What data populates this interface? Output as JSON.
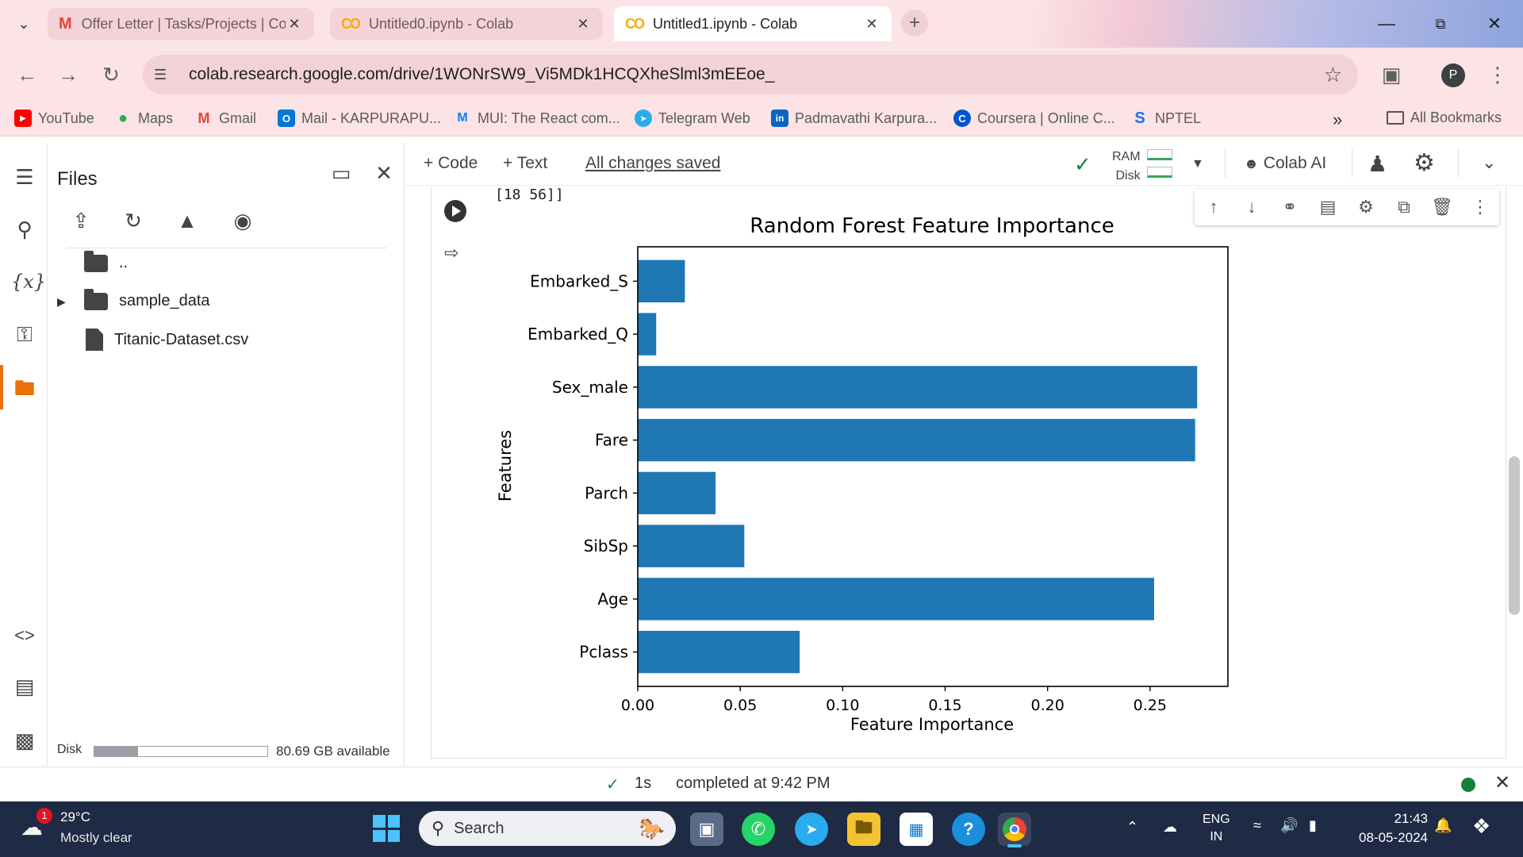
{
  "browser": {
    "tabs": [
      {
        "label": "Offer Letter | Tasks/Projects | Co",
        "icon": "gmail-icon"
      },
      {
        "label": "Untitled0.ipynb - Colab",
        "icon": "colab-icon"
      },
      {
        "label": "Untitled1.ipynb - Colab",
        "icon": "colab-icon"
      }
    ],
    "url": "colab.research.google.com/drive/1WONrSW9_Vi5MDk1HCQXheSlml3mEEoe_",
    "profile_initial": "P",
    "bookmarks": [
      {
        "label": "YouTube",
        "color": "#ff0000"
      },
      {
        "label": "Maps",
        "color": "#34a853"
      },
      {
        "label": "Gmail",
        "color": "#ea4335"
      },
      {
        "label": "Mail - KARPURAPU...",
        "color": "#0078d4"
      },
      {
        "label": "MUI: The React com...",
        "color": "#007fff"
      },
      {
        "label": "Telegram Web",
        "color": "#2aabee"
      },
      {
        "label": "Padmavathi Karpura...",
        "color": "#0a66c2"
      },
      {
        "label": "Coursera | Online C...",
        "color": "#0056d2"
      },
      {
        "label": "NPTEL",
        "color": "#1a73e8"
      }
    ],
    "all_bookmarks": "All Bookmarks"
  },
  "files": {
    "title": "Files",
    "parent": "..",
    "items": [
      {
        "name": "sample_data",
        "type": "folder"
      },
      {
        "name": "Titanic-Dataset.csv",
        "type": "file"
      }
    ],
    "disk_label": "Disk",
    "disk_available": "80.69 GB available",
    "disk_used_fraction": 0.25
  },
  "toolbar": {
    "code": "+ Code",
    "text": "+ Text",
    "saved": "All changes saved",
    "ram": "RAM",
    "disk": "Disk",
    "colab_ai": "Colab AI"
  },
  "cell": {
    "output_text": "[18 56]]"
  },
  "chart_data": {
    "type": "bar",
    "orientation": "horizontal",
    "title": "Random Forest Feature Importance",
    "xlabel": "Feature Importance",
    "ylabel": "Features",
    "categories": [
      "Pclass",
      "Age",
      "SibSp",
      "Parch",
      "Fare",
      "Sex_male",
      "Embarked_Q",
      "Embarked_S"
    ],
    "values": [
      0.079,
      0.252,
      0.052,
      0.038,
      0.272,
      0.273,
      0.009,
      0.023
    ],
    "xlim": [
      0,
      0.288
    ],
    "xticks": [
      "0.00",
      "0.05",
      "0.10",
      "0.15",
      "0.20",
      "0.25"
    ],
    "bar_color": "#1f77b4",
    "grid": false
  },
  "status": {
    "duration": "1s",
    "completed": "completed at 9:42 PM"
  },
  "taskbar": {
    "temperature": "29°C",
    "weather": "Mostly clear",
    "weather_badge": "1",
    "search_placeholder": "Search",
    "language_top": "ENG",
    "language_bottom": "IN",
    "time": "21:43",
    "date": "08-05-2024"
  }
}
